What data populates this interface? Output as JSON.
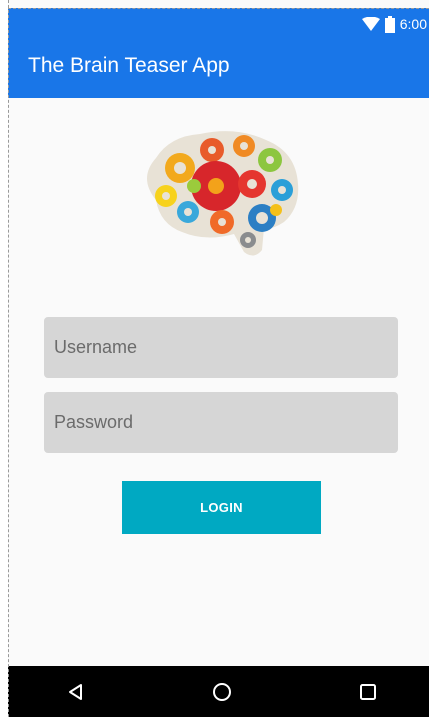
{
  "status_bar": {
    "time": "6:00",
    "wifi_icon": "wifi-icon",
    "battery_icon": "battery-icon"
  },
  "app_bar": {
    "title": "The Brain Teaser App"
  },
  "logo": {
    "icon": "brain-gears-logo"
  },
  "login_form": {
    "username": {
      "placeholder": "Username",
      "value": ""
    },
    "password": {
      "placeholder": "Password",
      "value": ""
    },
    "login_label": "LOGIN"
  },
  "nav_bar": {
    "back_icon": "back-triangle-icon",
    "home_icon": "home-circle-icon",
    "recent_icon": "recent-apps-square-icon"
  },
  "colors": {
    "app_bar": "#1976e8",
    "login_button": "#00a9c2",
    "field_background": "#d6d6d6",
    "nav_bar": "#000000",
    "background": "#fafafa"
  }
}
